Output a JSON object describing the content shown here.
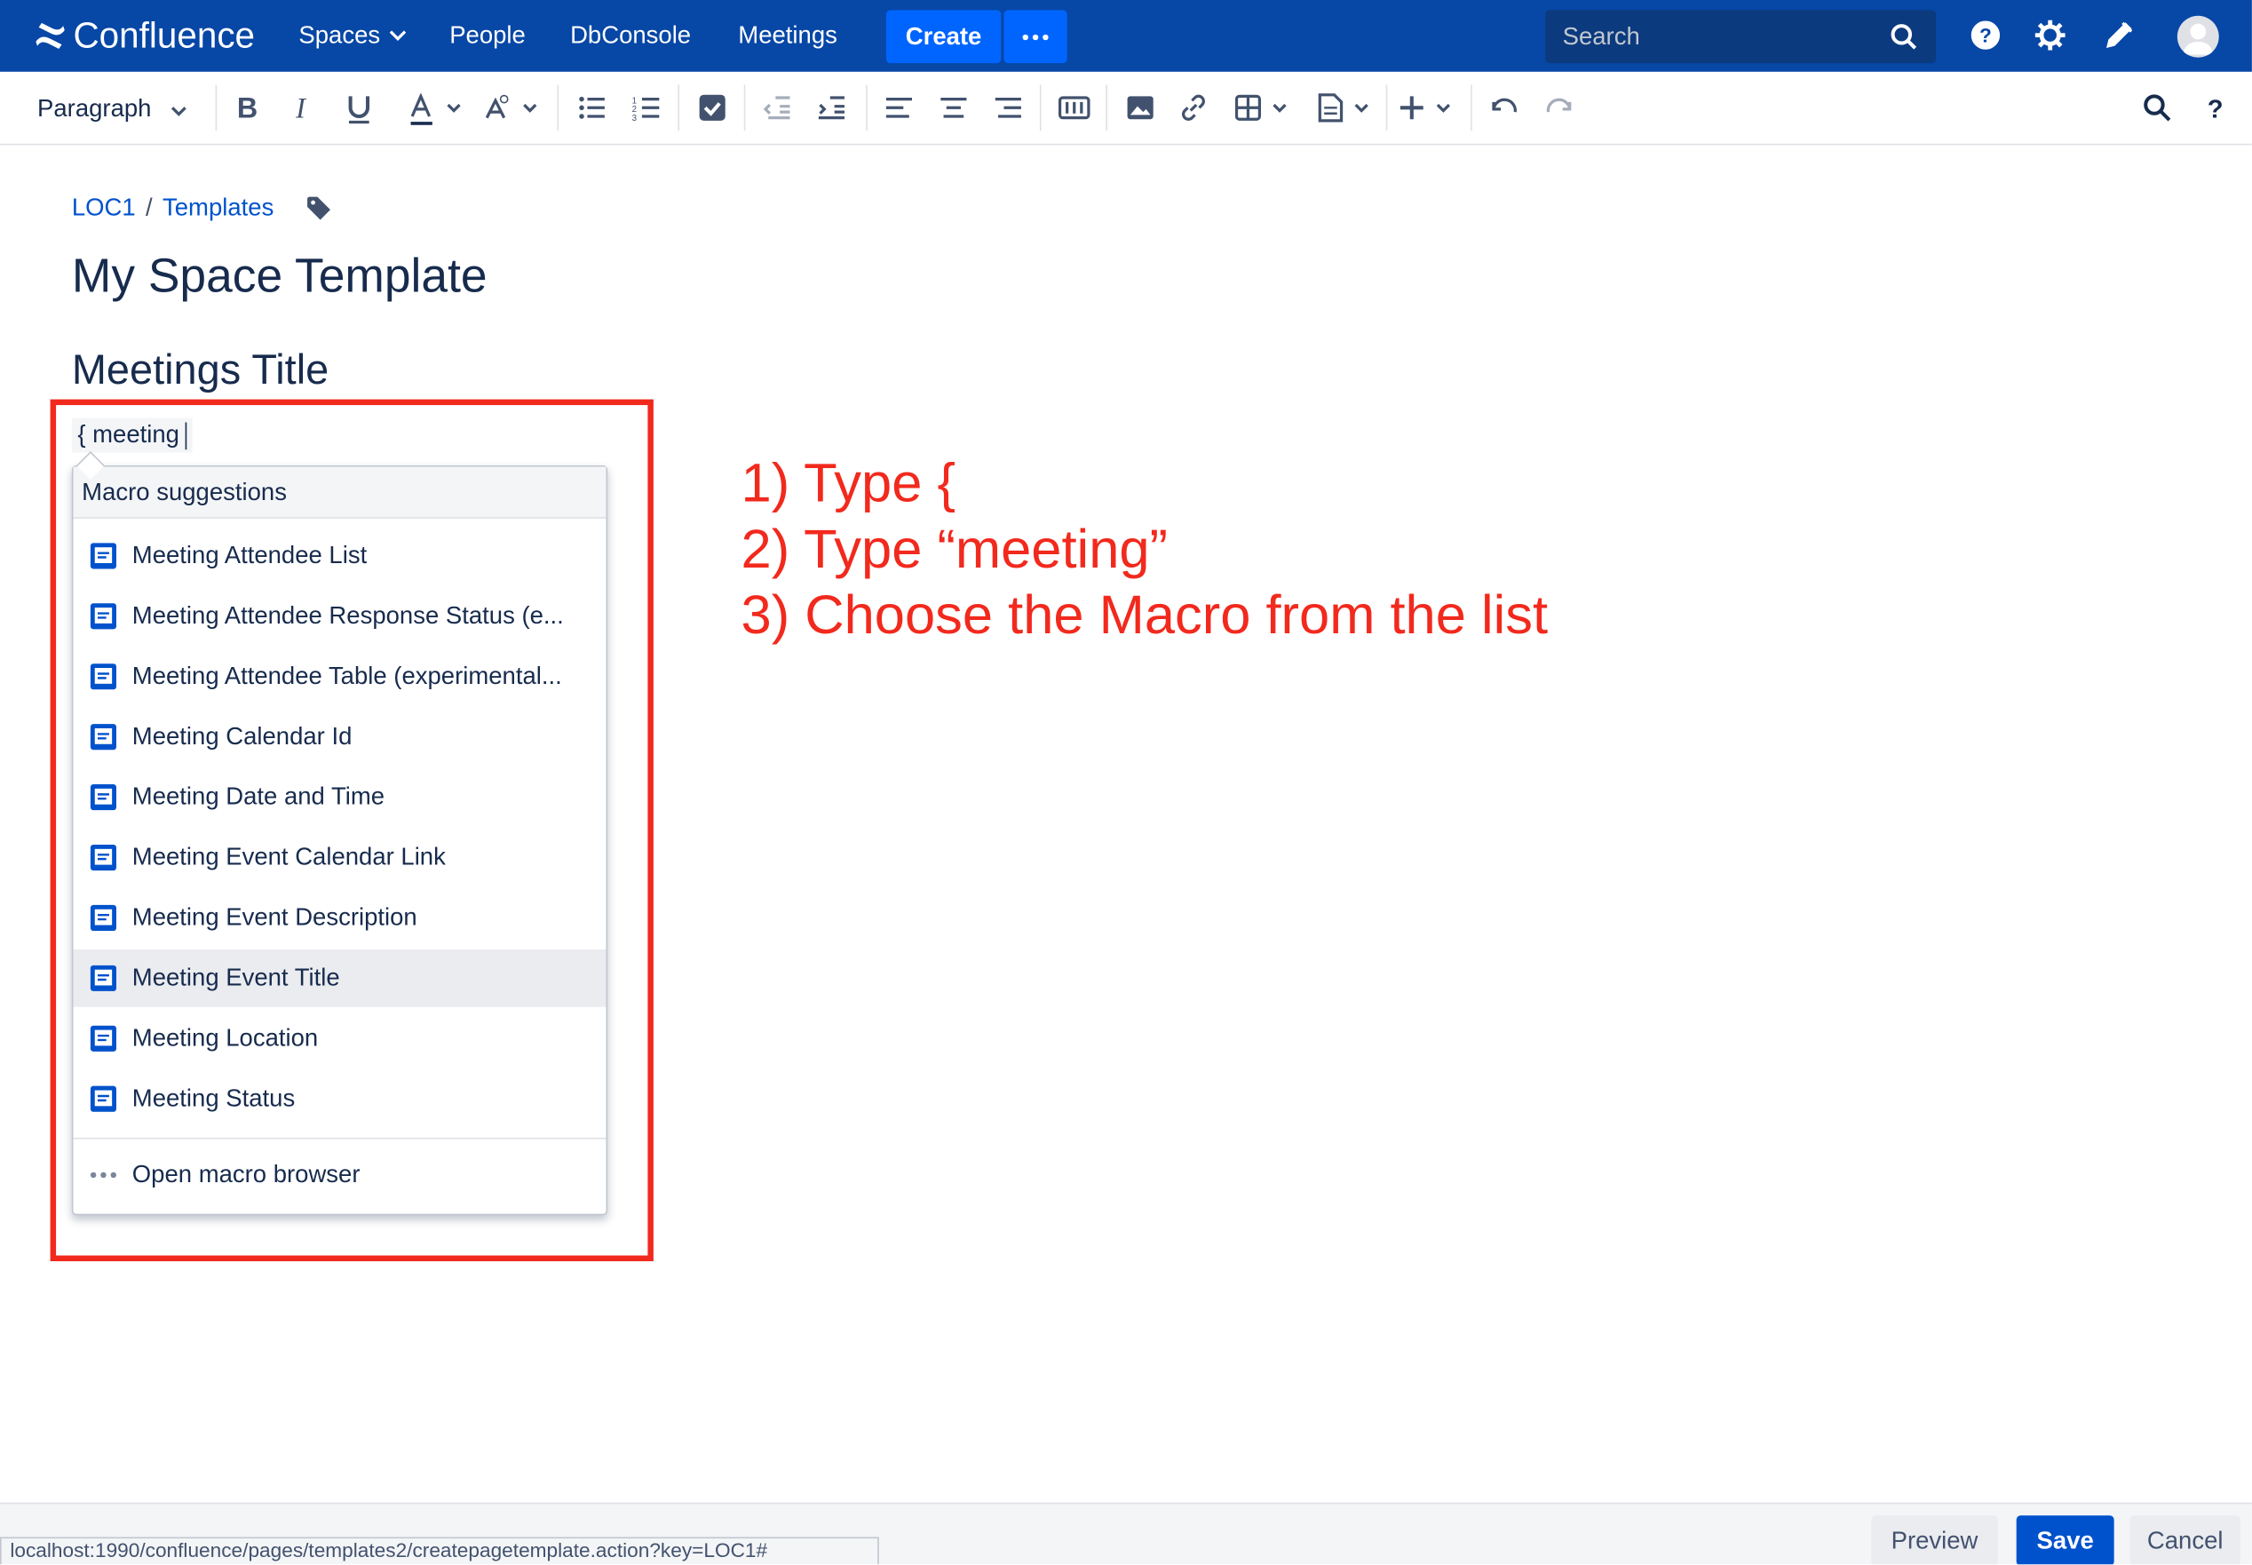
{
  "nav": {
    "brand": "Confluence",
    "spaces": "Spaces",
    "people": "People",
    "dbconsole": "DbConsole",
    "meetings": "Meetings",
    "create": "Create",
    "search_placeholder": "Search"
  },
  "toolbar": {
    "paragraph": "Paragraph"
  },
  "breadcrumb": {
    "space": "LOC1",
    "sep": "/",
    "page": "Templates"
  },
  "page": {
    "title": "My Space Template",
    "heading": "Meetings Title",
    "typed": "{ meeting"
  },
  "macros": {
    "header": "Macro suggestions",
    "items": [
      "Meeting Attendee List",
      "Meeting Attendee Response Status (e...",
      "Meeting Attendee Table (experimental...",
      "Meeting Calendar Id",
      "Meeting Date and Time",
      "Meeting Event Calendar Link",
      "Meeting Event Description",
      "Meeting Event Title",
      "Meeting Location",
      "Meeting Status"
    ],
    "browse": "Open macro browser"
  },
  "annotation": {
    "line1": "1) Type {",
    "line2": "2) Type “meeting”",
    "line3": "3) Choose the Macro from the list",
    "color": "#f2291d"
  },
  "footer": {
    "preview": "Preview",
    "save": "Save",
    "cancel": "Cancel"
  },
  "status_url": "localhost:1990/confluence/pages/templates2/createpagetemplate.action?key=LOC1#",
  "colors": {
    "nav": "#0747a6",
    "accent": "#0065ff"
  }
}
